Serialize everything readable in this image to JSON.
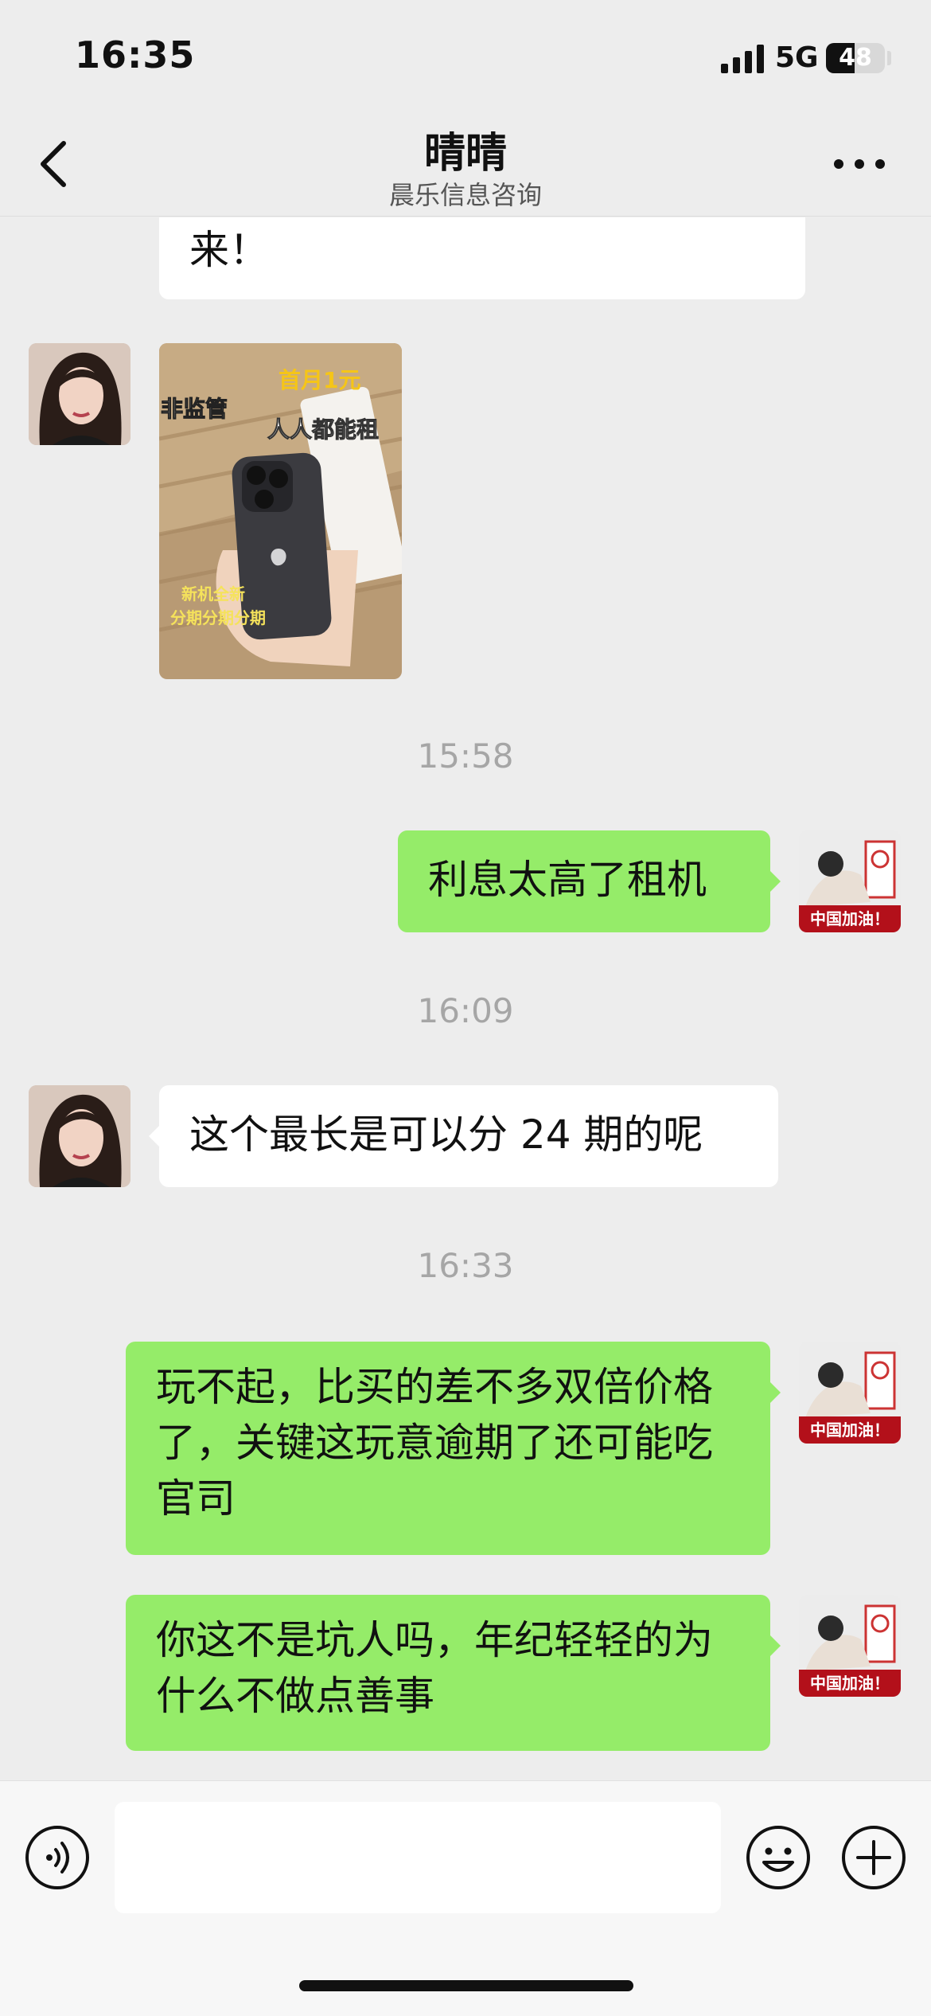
{
  "status_bar": {
    "time": "16:35",
    "network": "5G",
    "battery": "48",
    "battery_level": 0.48
  },
  "nav": {
    "back_icon": "chevron-left-icon",
    "title": "晴晴",
    "subtitle": "晨乐信息咨询",
    "more_icon": "more-horizontal-icon"
  },
  "messages": {
    "m0_text": "来！",
    "m1_image": {
      "caption_left": "非监管",
      "caption_top": "首月1元",
      "caption_mid": "人人都能租",
      "caption_bottom_1": "新机全新",
      "caption_bottom_2": "分期分期分期"
    },
    "t1": "15:58",
    "m2_text": "利息太高了租机",
    "t2": "16:09",
    "m3_text": "这个最长是可以分 24 期的呢",
    "t3": "16:33",
    "m4_text": "玩不起，比买的差不多双倍价格了，关键这玩意逾期了还可能吃官司",
    "m5_text": "你这不是坑人吗，年纪轻轻的为什么不做点善事",
    "my_avatar_badge": "中国加油！"
  },
  "input": {
    "placeholder": "",
    "voice_icon": "voice-icon",
    "emoji_icon": "emoji-icon",
    "plus_icon": "plus-circle-icon"
  },
  "colors": {
    "background": "#ededed",
    "outgoing_bubble": "#95ec69",
    "incoming_bubble": "#ffffff",
    "timestamp": "#a6a6a6"
  }
}
